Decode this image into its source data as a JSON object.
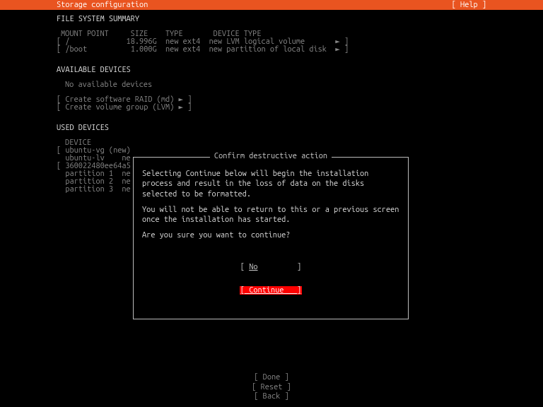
{
  "header": {
    "title": "Storage configuration",
    "help": "[ Help ]"
  },
  "fs_summary": {
    "title": "FILE SYSTEM SUMMARY",
    "headers": "MOUNT POINT     SIZE    TYPE       DEVICE TYPE",
    "rows": [
      "[ /             18.996G  new ext4  new LVM logical volume       ► ]",
      "[ /boot          1.000G  new ext4  new partition of local disk  ► ]"
    ]
  },
  "available": {
    "title": "AVAILABLE DEVICES",
    "none": "No available devices",
    "raid": "[ Create software RAID (md) ► ]",
    "lvm": "[ Create volume group (LVM) ► ]"
  },
  "used": {
    "title": "USED DEVICES",
    "device_label": "DEVICE",
    "rows": [
      "[ ubuntu-vg (new)",
      "  ubuntu-lv    ne",
      "",
      "[ 360022480ee64a5",
      "  partition 1  ne",
      "  partition 2  ne",
      "  partition 3  ne"
    ]
  },
  "dialog": {
    "title": "Confirm destructive action",
    "p1": "Selecting Continue below will begin the installation process and result in the loss of data on the disks selected to be formatted.",
    "p2": "You will not be able to return to this or a previous screen once the installation has started.",
    "p3": "Are you sure you want to continue?",
    "no_label_left": "[ ",
    "no_label": "No",
    "no_label_right": "         ]",
    "continue_left": "[ ",
    "continue": "Continue   ",
    "continue_right": "]"
  },
  "bottom": {
    "done": "[ Done       ]",
    "reset": "[ Reset      ]",
    "back": "[ Back       ]"
  }
}
